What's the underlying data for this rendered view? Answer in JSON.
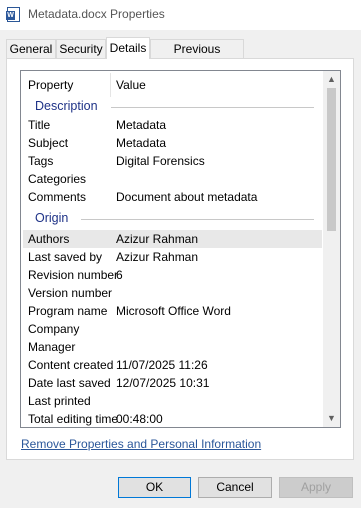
{
  "window": {
    "title": "Metadata.docx Properties",
    "icon": "word-document-icon"
  },
  "tabs": [
    {
      "label": "General",
      "active": false
    },
    {
      "label": "Security",
      "active": false
    },
    {
      "label": "Details",
      "active": true
    },
    {
      "label": "Previous Versions",
      "active": false
    }
  ],
  "columns": {
    "property": "Property",
    "value": "Value"
  },
  "groups": {
    "description": "Description",
    "origin": "Origin"
  },
  "description_rows": [
    {
      "property": "Title",
      "value": "Metadata"
    },
    {
      "property": "Subject",
      "value": "Metadata"
    },
    {
      "property": "Tags",
      "value": "Digital Forensics"
    },
    {
      "property": "Categories",
      "value": ""
    },
    {
      "property": "Comments",
      "value": "Document about metadata"
    }
  ],
  "origin_rows": [
    {
      "property": "Authors",
      "value": "Azizur Rahman",
      "highlighted": true
    },
    {
      "property": "Last saved by",
      "value": "Azizur Rahman"
    },
    {
      "property": "Revision number",
      "value": "6"
    },
    {
      "property": "Version number",
      "value": ""
    },
    {
      "property": "Program name",
      "value": "Microsoft Office Word"
    },
    {
      "property": "Company",
      "value": ""
    },
    {
      "property": "Manager",
      "value": ""
    },
    {
      "property": "Content created",
      "value": "11/07/2025 11:26"
    },
    {
      "property": "Date last saved",
      "value": "12/07/2025 10:31"
    },
    {
      "property": "Last printed",
      "value": ""
    },
    {
      "property": "Total editing time",
      "value": "00:48:00"
    }
  ],
  "link": "Remove Properties and Personal Information",
  "buttons": {
    "ok": "OK",
    "cancel": "Cancel",
    "apply": "Apply"
  },
  "scroll": {
    "up": "▲",
    "down": "▼"
  }
}
